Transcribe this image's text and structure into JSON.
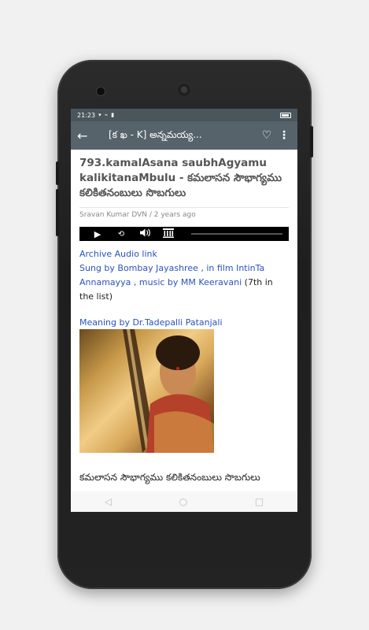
{
  "status": {
    "time": "21:23",
    "icons": "▾ ⌁ ▮"
  },
  "appbar": {
    "back_icon": "arrow-back-icon",
    "title": "[క ఖ - K] అన్నమయ్య...",
    "favorite_icon": "heart-icon",
    "menu_icon": "more-vert-icon"
  },
  "post": {
    "title": "793.kamalAsana saubhAgyamu kalikitanaMbulu - కమలాసన సౌభాగ్యము కలికితనంబులు సొబగులు",
    "author": "Sravan Kumar DVN / 2 years ago",
    "audio_link": "Archive Audio link",
    "sung_by_link": "Sung by Bombay Jayashree , in film IntinTa Annamayya , music by MM Keeravani",
    "sung_by_suffix": " (7th in the list)",
    "meaning_link": "Meaning by Dr.Tadepalli Patanjali",
    "lyrics_start": "కమలాసన సౌభాగ్యము కలికితనంబులు సొబగులు"
  },
  "player": {
    "play_icon": "▶",
    "rewind_icon": "⟲",
    "volume_icon": "🔊",
    "archive_icon": "archive-icon"
  },
  "nav": {
    "back": "◁",
    "home": "○",
    "recents": "□"
  }
}
